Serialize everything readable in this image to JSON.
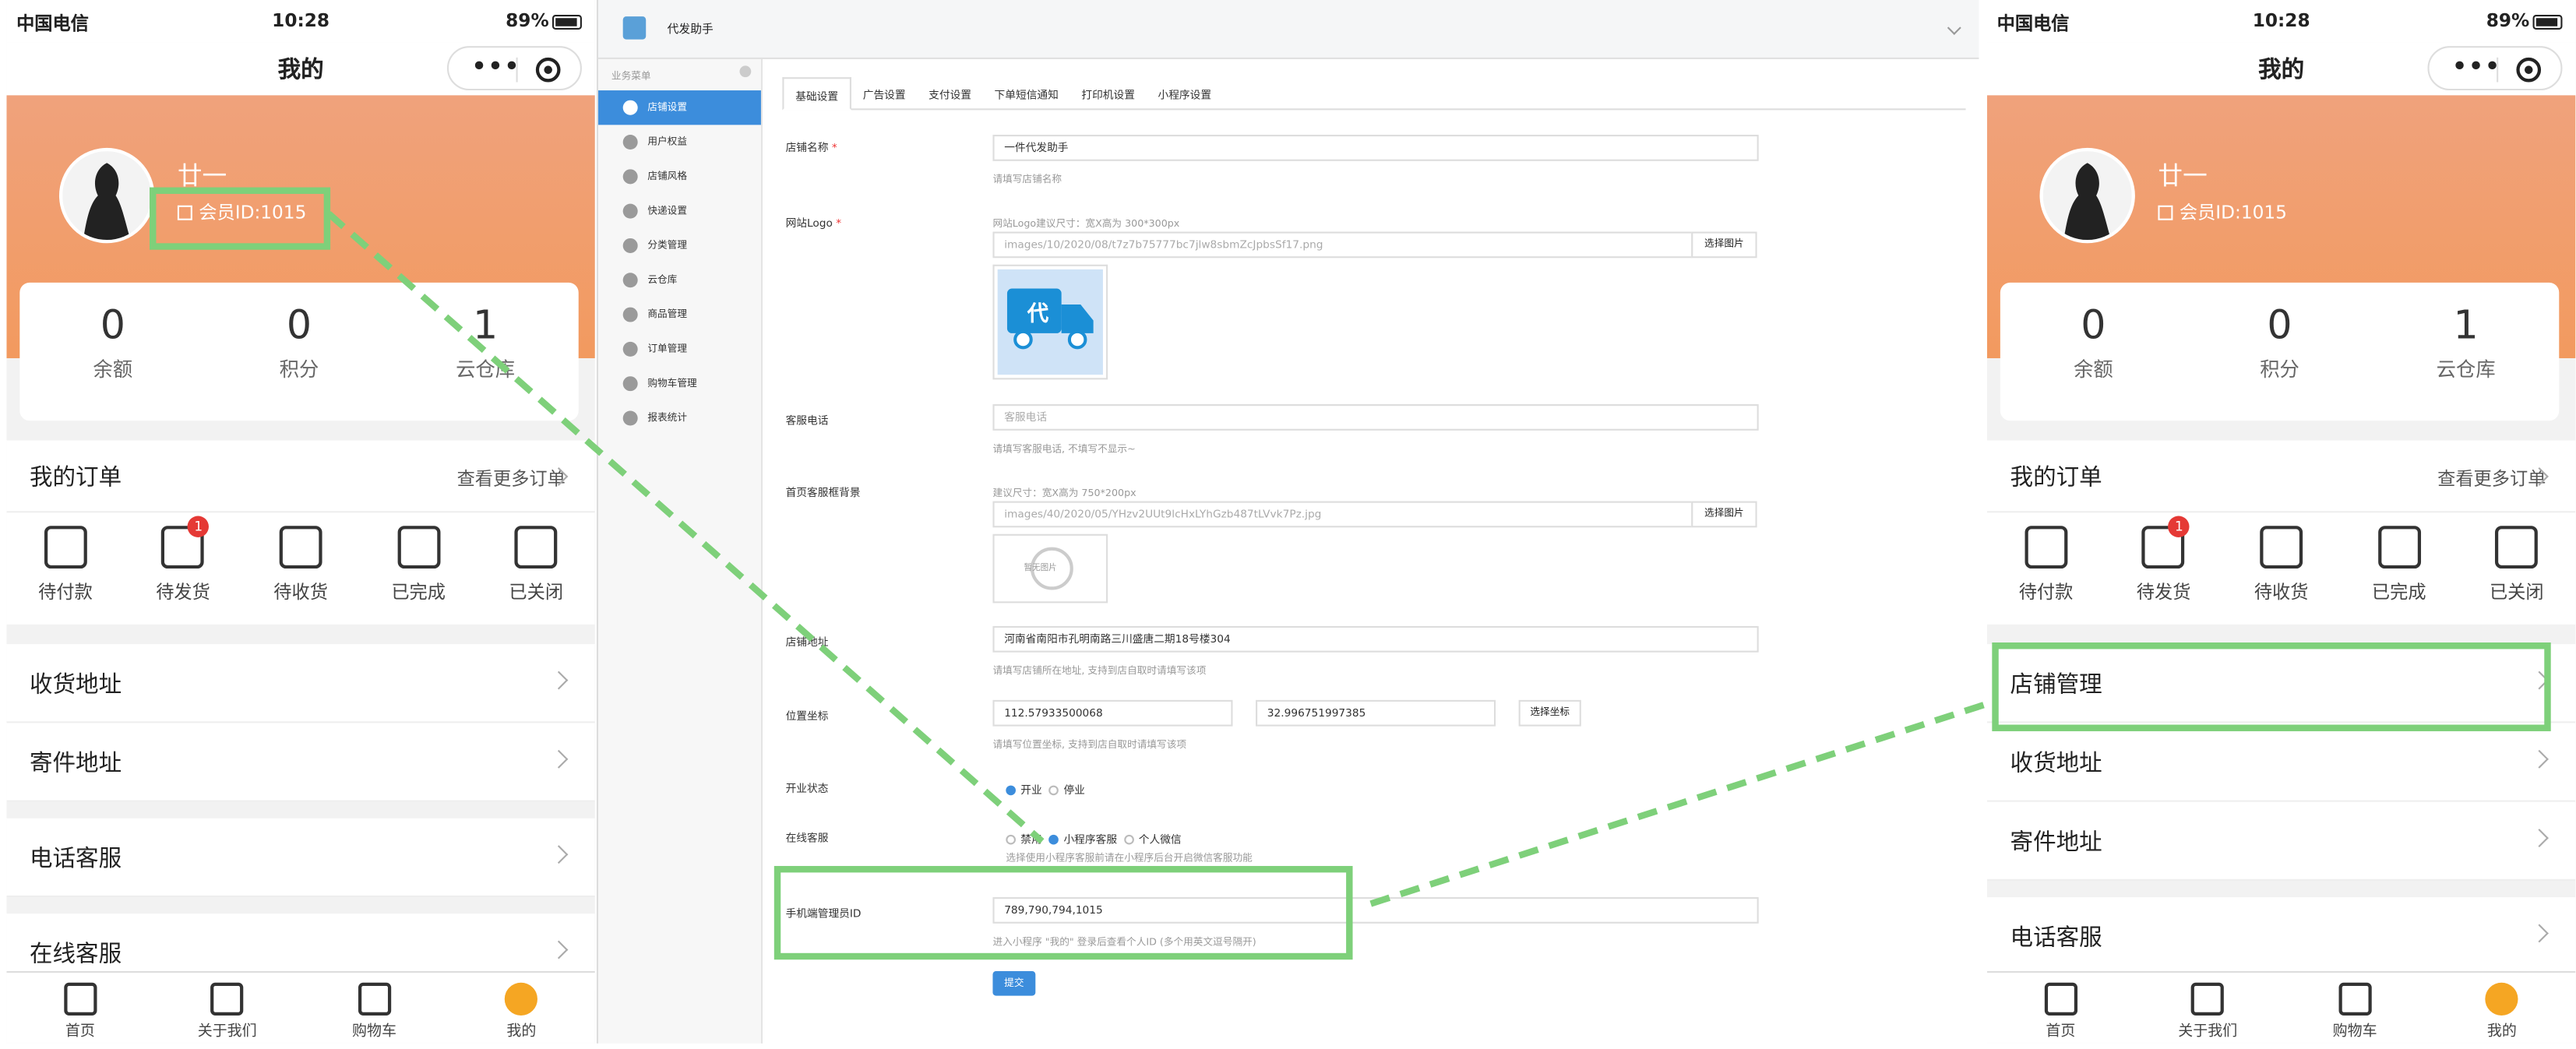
{
  "phone_left": {
    "status": {
      "carrier": "中国电信",
      "time": "10:28",
      "battery": "89%"
    },
    "nav_title": "我的",
    "user": {
      "name": "廿一",
      "member_id": "会员ID:1015"
    },
    "stats": [
      {
        "value": "0",
        "label": "余额"
      },
      {
        "value": "0",
        "label": "积分"
      },
      {
        "value": "1",
        "label": "云仓库"
      }
    ],
    "orders": {
      "title": "我的订单",
      "more": "查看更多订单",
      "items": [
        {
          "label": "待付款",
          "icon": "wallet-icon"
        },
        {
          "label": "待发货",
          "icon": "clock-doc-icon",
          "badge": "1"
        },
        {
          "label": "待收货",
          "icon": "truck-icon"
        },
        {
          "label": "已完成",
          "icon": "check-doc-icon"
        },
        {
          "label": "已关闭",
          "icon": "closed-wallet-icon"
        }
      ]
    },
    "menu": [
      "收货地址",
      "寄件地址",
      "电话客服",
      "在线客服"
    ],
    "tabbar": [
      "首页",
      "关于我们",
      "购物车",
      "我的"
    ]
  },
  "phone_right": {
    "status": {
      "carrier": "中国电信",
      "time": "10:28",
      "battery": "89%"
    },
    "nav_title": "我的",
    "user": {
      "name": "廿一",
      "member_id": "会员ID:1015"
    },
    "stats": [
      {
        "value": "0",
        "label": "余额"
      },
      {
        "value": "0",
        "label": "积分"
      },
      {
        "value": "1",
        "label": "云仓库"
      }
    ],
    "orders": {
      "title": "我的订单",
      "more": "查看更多订单",
      "items": [
        {
          "label": "待付款"
        },
        {
          "label": "待发货",
          "badge": "1"
        },
        {
          "label": "待收货"
        },
        {
          "label": "已完成"
        },
        {
          "label": "已关闭"
        }
      ]
    },
    "menu": [
      "店铺管理",
      "收货地址",
      "寄件地址",
      "电话客服"
    ],
    "tabbar": [
      "首页",
      "关于我们",
      "购物车",
      "我的"
    ]
  },
  "admin": {
    "app_name": "代发助手",
    "sidebar_header": "业务菜单",
    "sidebar": [
      "店铺设置",
      "用户权益",
      "店铺风格",
      "快递设置",
      "分类管理",
      "云仓库",
      "商品管理",
      "订单管理",
      "购物车管理",
      "报表统计"
    ],
    "tabs": [
      "基础设置",
      "广告设置",
      "支付设置",
      "下单短信通知",
      "打印机设置",
      "小程序设置"
    ],
    "form": {
      "shop_name_label": "店铺名称",
      "shop_name_value": "一件代发助手",
      "shop_name_help": "请填写店铺名称",
      "logo_label": "网站Logo",
      "logo_size_help": "网站Logo建议尺寸：宽X高为 300*300px",
      "logo_path": "images/10/2020/08/t7z7b75777bc7jlw8sbmZcJpbsSf17.png",
      "select_image": "选择图片",
      "logo_char": "代",
      "phone_label": "客服电话",
      "phone_placeholder": "客服电话",
      "phone_help": "请填写客服电话, 不填写不显示~",
      "bg_label": "首页客服框背景",
      "bg_size_help": "建议尺寸：宽X高为 750*200px",
      "bg_path": "images/40/2020/05/YHzv2UUt9lcHxLYhGzb487tLVvk7Pz.jpg",
      "no_image": "暂无图片",
      "address_label": "店铺地址",
      "address_value": "河南省南阳市孔明南路三川盛唐二期18号楼304",
      "address_help": "请填写店铺所在地址, 支持到店自取时请填写该项",
      "coord_label": "位置坐标",
      "coord_lng": "112.57933500068",
      "coord_lat": "32.996751997385",
      "select_coord": "选择坐标",
      "coord_help": "请填写位置坐标, 支持到店自取时请填写该项",
      "open_label": "开业状态",
      "open_opts": [
        "开业",
        "停业"
      ],
      "cs_label": "在线客服",
      "cs_opts": [
        "禁用",
        "小程序客服",
        "个人微信"
      ],
      "cs_help": "选择使用小程序客服前请在小程序后台开启微信客服功能",
      "admin_id_label": "手机端管理员ID",
      "admin_id_value": "789,790,794,1015",
      "admin_id_help": "进入小程序 \"我的\" 登录后查看个人ID (多个用英文逗号隔开)",
      "submit": "提交"
    }
  },
  "colors": {
    "highlight": "#7ed07a",
    "accent": "#3c8ddc",
    "hero": "#f29a5f"
  }
}
